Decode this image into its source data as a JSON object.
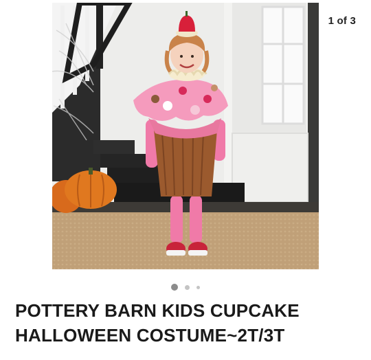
{
  "gallery": {
    "counter": "1 of 3",
    "image_alt": "Child wearing a pink and brown cupcake costume standing on a rug in front of a staircase with pumpkins",
    "total_images": 3,
    "active_index": 1
  },
  "listing": {
    "title": "POTTERY BARN KIDS CUPCAKE HALLOWEEN COSTUME~2T/3T"
  },
  "colors": {
    "title_text": "#1a1a1a",
    "dot_active": "#8c8c8c",
    "dot_inactive": "#c4c4c4"
  }
}
